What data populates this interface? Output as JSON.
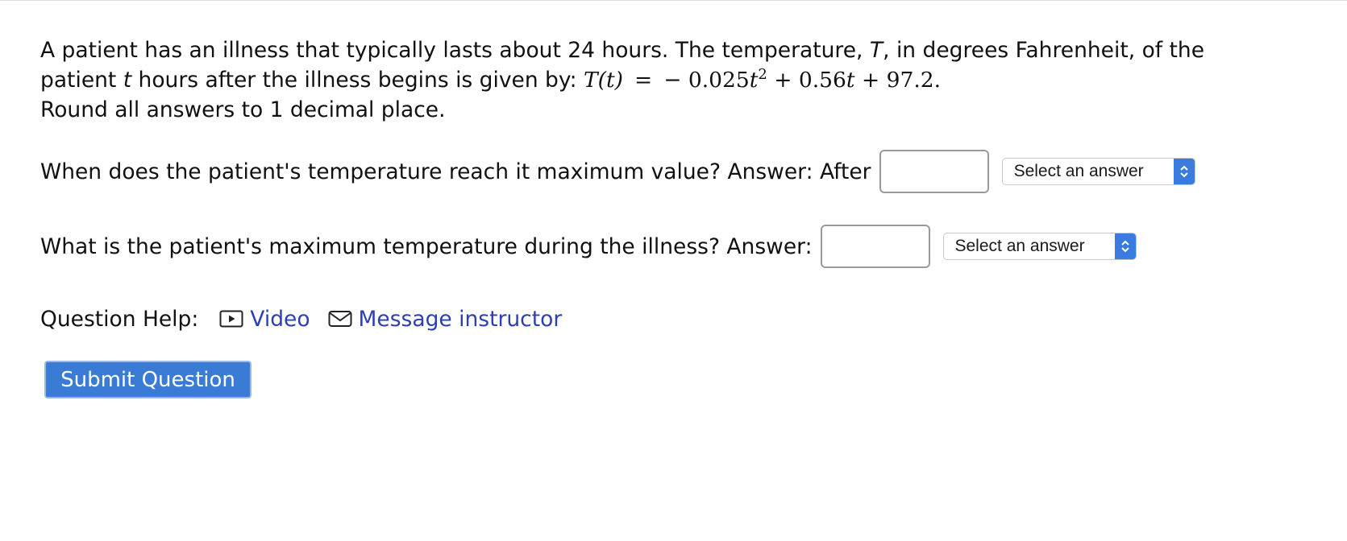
{
  "problem": {
    "line1": "A patient has an illness that typically lasts about 24 hours. The temperature, ",
    "var_T": "T",
    "line1_end": ", in degrees Fahrenheit, of the",
    "line2_start": "patient ",
    "var_t": "t",
    "line2_mid": " hours after the illness begins is given by: ",
    "formula_lhs": "T(t)",
    "formula_eq": "=",
    "formula_rhs_a": "− 0.025",
    "formula_rhs_t": "t",
    "formula_exp": "2",
    "formula_rhs_b": " + 0.56",
    "formula_rhs_t2": "t",
    "formula_rhs_c": " + 97.2.",
    "rounding": "Round all answers to 1 decimal place."
  },
  "question1": {
    "text": "When does the patient's temperature reach it maximum value?  Answer: After",
    "input_value": "",
    "select_label": "Select an answer"
  },
  "question2": {
    "text": "What is the patient's maximum temperature during the illness?  Answer:",
    "input_value": "",
    "select_label": "Select an answer"
  },
  "help": {
    "title": "Question Help:",
    "video_label": "Video",
    "message_label": "Message instructor",
    "link_color": "#2c3fb4"
  },
  "submit": {
    "label": "Submit Question",
    "color": "#3a7bd5"
  }
}
